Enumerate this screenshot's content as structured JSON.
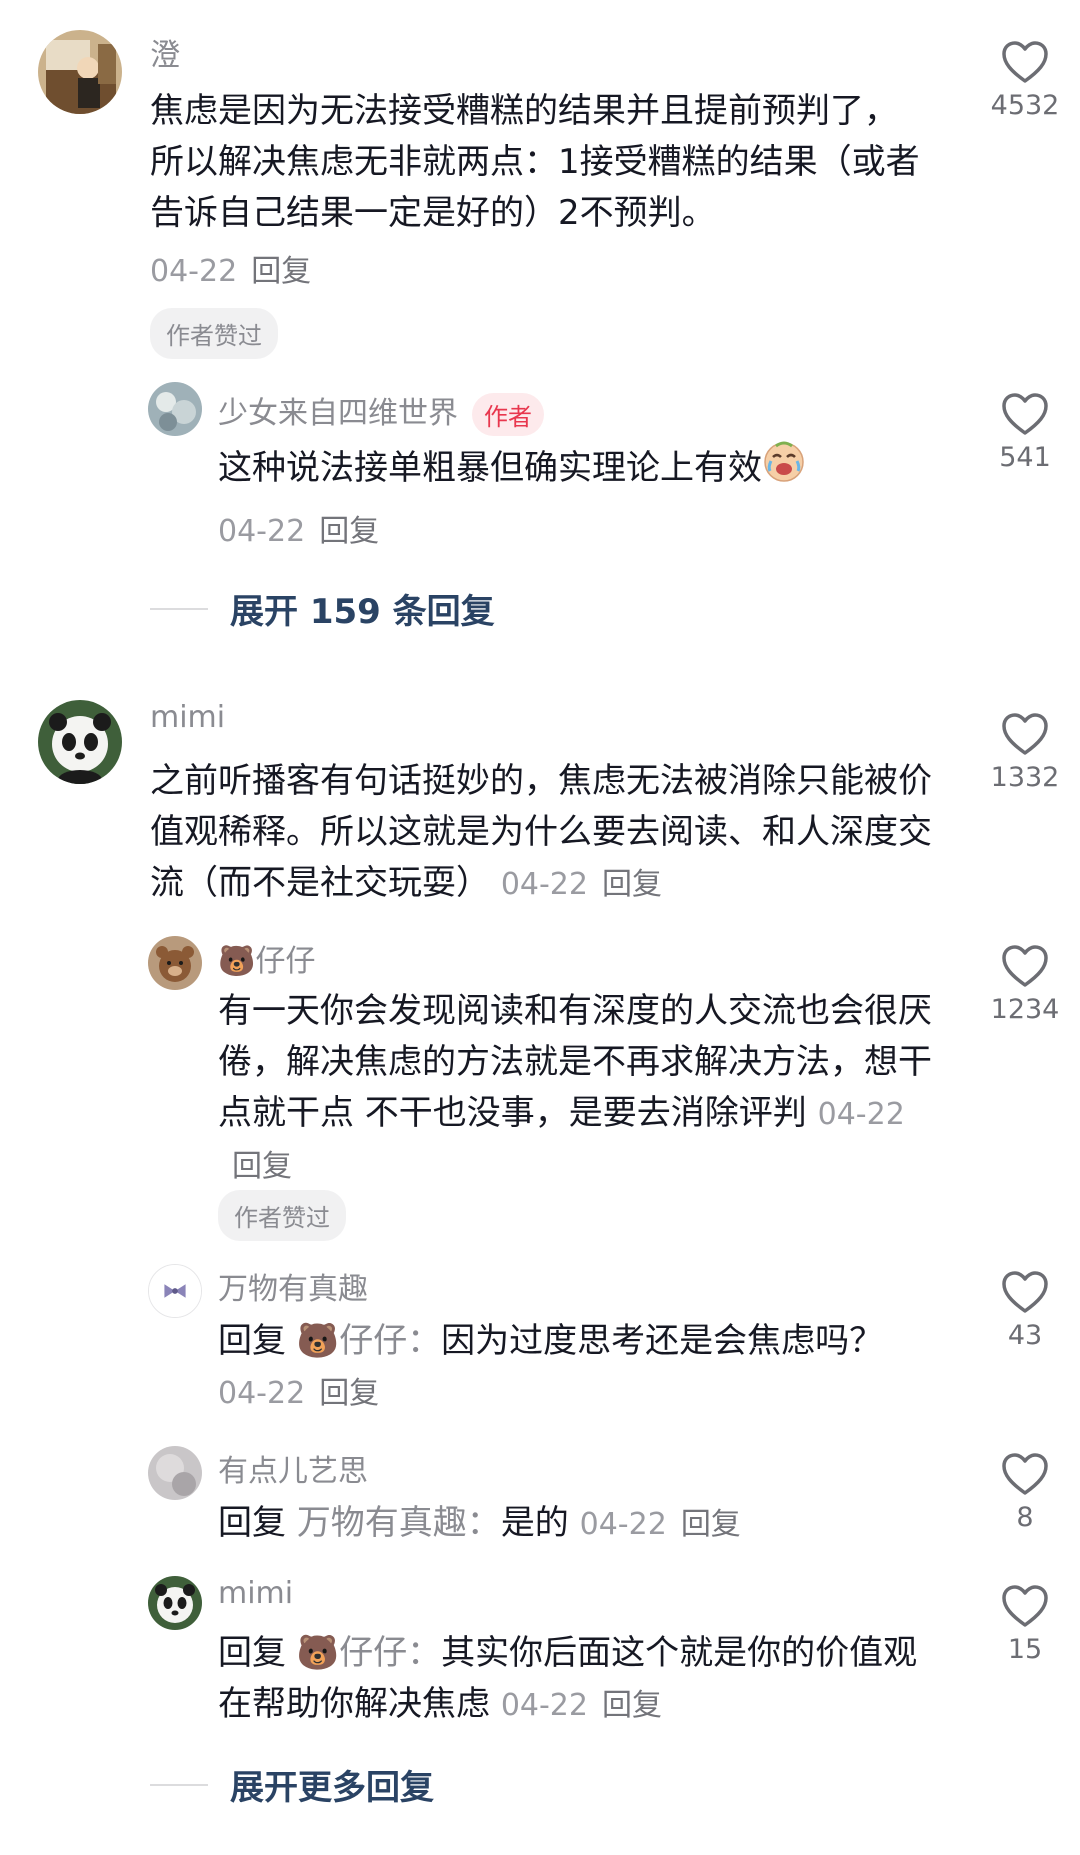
{
  "comments": [
    {
      "user": "澄",
      "text": "焦虑是因为无法接受糟糕的结果并且提前预判了，所以解决焦虑无非就两点：1接受糟糕的结果（或者告诉自己结果一定是好的）2不预判。",
      "date": "04-22",
      "reply_label": "回复",
      "likes": "4532",
      "liked_by_author": "作者赞过",
      "replies": [
        {
          "user": "少女来自四维世界",
          "badge": "作者",
          "text": "这种说法接单粗暴但确实理论上有效",
          "emoji": "laughing-crying-face-icon",
          "date": "04-22",
          "reply_label": "回复",
          "likes": "541"
        }
      ],
      "expand_label": "展开 159 条回复"
    },
    {
      "user": "mimi",
      "text": "之前听播客有句话挺妙的，焦虑无法被消除只能被价值观稀释。所以这就是为什么要去阅读、和人深度交流（而不是社交玩耍）",
      "date": "04-22",
      "reply_label": "回复",
      "likes": "1332",
      "replies": [
        {
          "user_emoji": "🐻",
          "user": "仔仔",
          "text": "有一天你会发现阅读和有深度的人交流也会很厌倦，解决焦虑的方法就是不再求解决方法，想干点就干点 不干也没事，是要去消除评判",
          "date": "04-22",
          "reply_label": "回复",
          "likes": "1234",
          "liked_by_author": "作者赞过"
        },
        {
          "user": "万物有真趣",
          "reply_prefix": "回复",
          "reply_to_emoji": "🐻",
          "reply_to": "仔仔：",
          "text": "因为过度思考还是会焦虑吗？",
          "date": "04-22",
          "reply_label": "回复",
          "likes": "43"
        },
        {
          "user": "有点儿艺思",
          "reply_prefix": "回复",
          "reply_to": "万物有真趣：",
          "text": "是的",
          "date": "04-22",
          "reply_label": "回复",
          "likes": "8"
        },
        {
          "user": "mimi",
          "reply_prefix": "回复",
          "reply_to_emoji": "🐻",
          "reply_to": "仔仔：",
          "text": "其实你后面这个就是你的价值观在帮助你解决焦虑",
          "date": "04-22",
          "reply_label": "回复",
          "likes": "15"
        }
      ],
      "expand_label": "展开更多回复"
    }
  ],
  "colors": {
    "text": "#161823",
    "secondary": "#8a8b91",
    "author_badge_bg": "#fdeaec",
    "author_badge_text": "#e8374e",
    "expand_link": "#2a4364"
  }
}
